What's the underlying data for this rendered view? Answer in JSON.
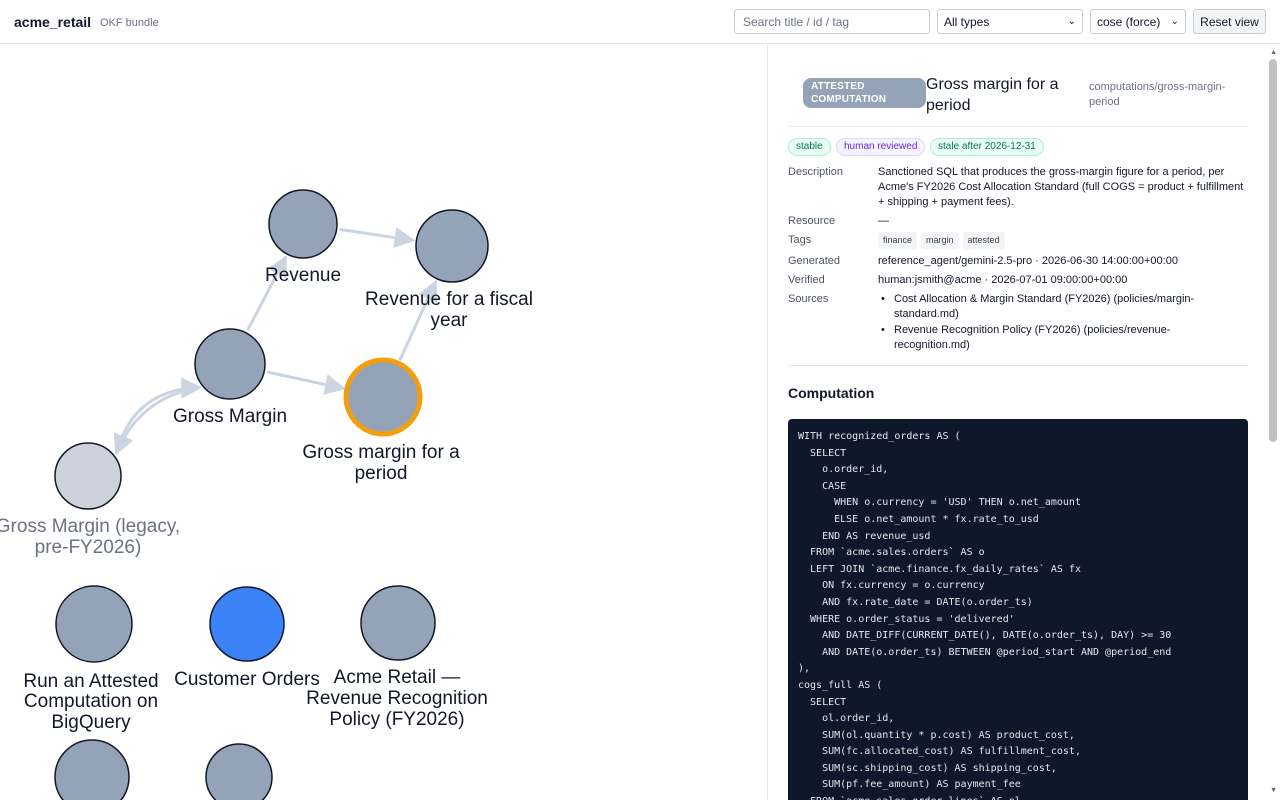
{
  "header": {
    "brand": "acme_retail",
    "bundle": "OKF bundle",
    "search_placeholder": "Search title / id / tag",
    "type_filter": "All types",
    "layout": "cose (force)",
    "reset_label": "Reset view"
  },
  "graph": {
    "nodes": [
      {
        "id": "revenue",
        "label": "Revenue",
        "color": "#94a3b8"
      },
      {
        "id": "revenue_fiscal",
        "label": "Revenue for a fiscal year",
        "color": "#94a3b8"
      },
      {
        "id": "gross_margin",
        "label": "Gross Margin",
        "color": "#94a3b8"
      },
      {
        "id": "gm_period",
        "label": "Gross margin for a period",
        "color": "#94a3b8",
        "selected": true
      },
      {
        "id": "gm_legacy",
        "label": "Gross Margin (legacy, pre-FY2026)",
        "color": "#cbd2dc"
      },
      {
        "id": "run_attested",
        "label": "Run an Attested Computation on BigQuery",
        "color": "#94a3b8"
      },
      {
        "id": "customer_orders",
        "label": "Customer Orders",
        "color": "#3b82f6"
      },
      {
        "id": "rev_policy",
        "label": "Acme Retail — Revenue Recognition Policy (FY2026)",
        "color": "#94a3b8"
      },
      {
        "id": "node_9",
        "label": "",
        "color": "#94a3b8"
      },
      {
        "id": "node_10",
        "label": "",
        "color": "#94a3b8"
      }
    ],
    "edges": [
      {
        "from": "revenue",
        "to": "revenue_fiscal"
      },
      {
        "from": "gross_margin",
        "to": "revenue"
      },
      {
        "from": "gross_margin",
        "to": "gm_period"
      },
      {
        "from": "gm_period",
        "to": "revenue_fiscal"
      },
      {
        "from": "gm_legacy",
        "to": "gross_margin"
      },
      {
        "from": "gross_margin",
        "to": "gm_legacy"
      }
    ],
    "selected_border_color": "#f59e0b"
  },
  "detail": {
    "type_badge": "ATTESTED COMPUTATION",
    "title": "Gross margin for a period",
    "path": "computations/gross-margin-period",
    "chips": [
      "stable",
      "human reviewed",
      "stale after 2026-12-31"
    ],
    "fields": {
      "description_label": "Description",
      "description": "Sanctioned SQL that produces the gross-margin figure for a period, per Acme's FY2026 Cost Allocation Standard (full COGS = product + fulfillment + shipping + payment fees).",
      "resource_label": "Resource",
      "resource": "—",
      "tags_label": "Tags",
      "tags": [
        "finance",
        "margin",
        "attested"
      ],
      "generated_label": "Generated",
      "generated": "reference_agent/gemini-2.5-pro · 2026-06-30 14:00:00+00:00",
      "verified_label": "Verified",
      "verified": "human:jsmith@acme · 2026-07-01 09:00:00+00:00",
      "sources_label": "Sources",
      "sources": [
        "Cost Allocation & Margin Standard (FY2026) (policies/margin-standard.md)",
        "Revenue Recognition Policy (FY2026) (policies/revenue-recognition.md)"
      ]
    },
    "computation_heading": "Computation",
    "code": "WITH recognized_orders AS (\n  SELECT\n    o.order_id,\n    CASE\n      WHEN o.currency = 'USD' THEN o.net_amount\n      ELSE o.net_amount * fx.rate_to_usd\n    END AS revenue_usd\n  FROM `acme.sales.orders` AS o\n  LEFT JOIN `acme.finance.fx_daily_rates` AS fx\n    ON fx.currency = o.currency\n    AND fx.rate_date = DATE(o.order_ts)\n  WHERE o.order_status = 'delivered'\n    AND DATE_DIFF(CURRENT_DATE(), DATE(o.order_ts), DAY) >= 30\n    AND DATE(o.order_ts) BETWEEN @period_start AND @period_end\n),\ncogs_full AS (\n  SELECT\n    ol.order_id,\n    SUM(ol.quantity * p.cost) AS product_cost,\n    SUM(fc.allocated_cost) AS fulfillment_cost,\n    SUM(sc.shipping_cost) AS shipping_cost,\n    SUM(pf.fee_amount) AS payment_fee\n  FROM `acme.sales.order_lines` AS ol"
  }
}
